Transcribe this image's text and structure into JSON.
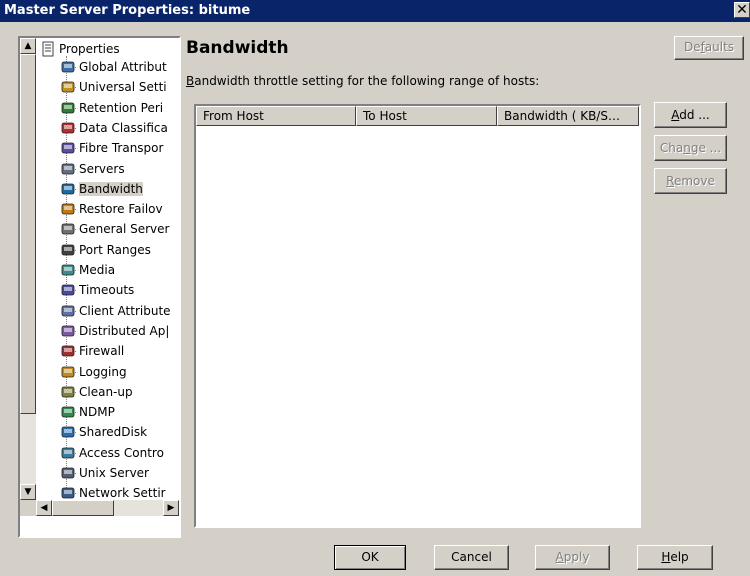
{
  "window": {
    "title": "Master Server Properties: bitume",
    "close_glyph": "✕"
  },
  "tree": {
    "root_label": "Properties",
    "items": [
      {
        "label": "Global Attribut",
        "icon": "globe-icon"
      },
      {
        "label": "Universal Setti",
        "icon": "universal-settings-icon"
      },
      {
        "label": "Retention Peri",
        "icon": "retention-icon"
      },
      {
        "label": "Data Classifica",
        "icon": "data-classification-icon"
      },
      {
        "label": "Fibre Transpor",
        "icon": "fibre-transport-icon"
      },
      {
        "label": "Servers",
        "icon": "server-icon"
      },
      {
        "label": "Bandwidth",
        "icon": "bandwidth-icon"
      },
      {
        "label": "Restore Failov",
        "icon": "restore-failover-icon"
      },
      {
        "label": "General Server",
        "icon": "general-server-icon"
      },
      {
        "label": "Port Ranges",
        "icon": "port-ranges-icon"
      },
      {
        "label": "Media",
        "icon": "media-icon"
      },
      {
        "label": "Timeouts",
        "icon": "clock-icon"
      },
      {
        "label": "Client Attribute",
        "icon": "client-attributes-icon"
      },
      {
        "label": "Distributed Ap|",
        "icon": "distributed-app-icon"
      },
      {
        "label": "Firewall",
        "icon": "firewall-icon"
      },
      {
        "label": "Logging",
        "icon": "logging-icon"
      },
      {
        "label": "Clean-up",
        "icon": "clean-up-icon"
      },
      {
        "label": "NDMP",
        "icon": "ndmp-icon"
      },
      {
        "label": "SharedDisk",
        "icon": "shared-disk-icon"
      },
      {
        "label": "Access Contro",
        "icon": "access-control-icon"
      },
      {
        "label": "Unix Server",
        "icon": "unix-server-icon"
      },
      {
        "label": "Network Settir",
        "icon": "network-settings-icon"
      }
    ],
    "selected": "Bandwidth"
  },
  "panel": {
    "heading": "Bandwidth",
    "description_prefix": "B",
    "description_rest": "andwidth throttle setting for the following range of hosts:",
    "defaults_prefix": "De",
    "defaults_u": "f",
    "defaults_rest": "aults"
  },
  "table": {
    "columns": [
      "From Host",
      "To Host",
      "Bandwidth ( KB/S…"
    ],
    "rows": []
  },
  "side_buttons": {
    "add_u": "A",
    "add_rest": "dd ...",
    "change_prefix": "Cha",
    "change_u": "n",
    "change_rest": "ge ...",
    "remove_u": "R",
    "remove_rest": "emove"
  },
  "footer": {
    "ok": "OK",
    "cancel": "Cancel",
    "apply_u": "A",
    "apply_rest": "pply",
    "help_u": "H",
    "help_rest": "elp"
  },
  "scroll_glyphs": {
    "up": "▲",
    "down": "▼",
    "left": "◀",
    "right": "▶"
  }
}
